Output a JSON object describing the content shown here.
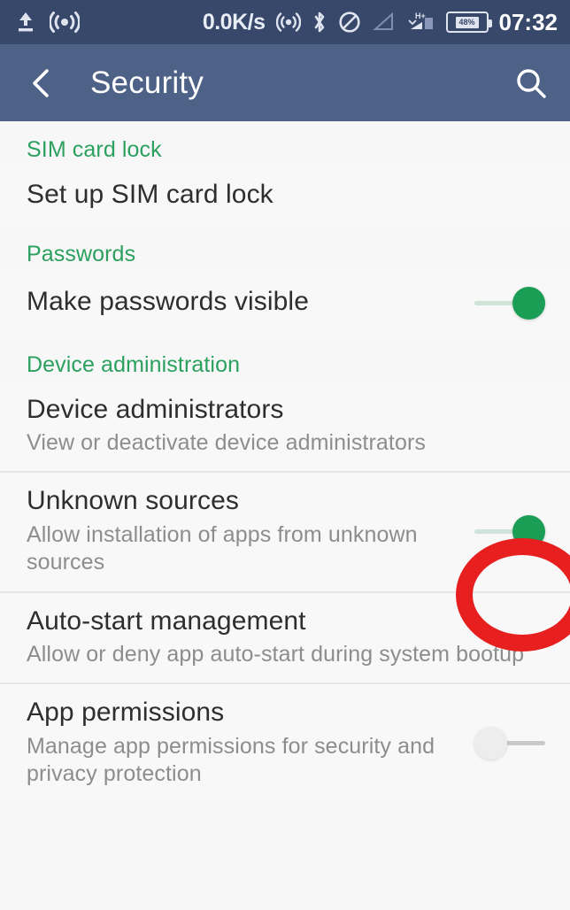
{
  "status_bar": {
    "network_speed": "0.0K/s",
    "clock": "07:32",
    "battery_percent": "48%",
    "icons": [
      "upload-arrow-icon",
      "broadcast-waves-icon",
      "hotspot-icon",
      "bluetooth-icon",
      "do-not-disturb-icon",
      "signal-empty-icon",
      "signal-hplus-icon",
      "battery-icon"
    ]
  },
  "app_bar": {
    "back_icon": "back-chevron-icon",
    "title": "Security",
    "search_icon": "search-icon"
  },
  "colors": {
    "status_bar_bg": "#37486b",
    "app_bar_bg": "#4e6287",
    "section_header_green": "#2ba05f",
    "toggle_on_green": "#1a9e55",
    "annotation_red": "#e81f1f",
    "page_bg": "#f7f7f7"
  },
  "sections": [
    {
      "header": "SIM card lock",
      "items": [
        {
          "title": "Set up SIM card lock",
          "subtitle": "",
          "toggle": null
        }
      ]
    },
    {
      "header": "Passwords",
      "items": [
        {
          "title": "Make passwords visible",
          "subtitle": "",
          "toggle": "on"
        }
      ]
    },
    {
      "header": "Device administration",
      "items": [
        {
          "title": "Device administrators",
          "subtitle": "View or deactivate device administrators",
          "toggle": null
        },
        {
          "title": "Unknown sources",
          "subtitle": "Allow installation of apps from unknown sources",
          "toggle": "on"
        },
        {
          "title": "Auto-start management",
          "subtitle": "Allow or deny app auto-start during system bootup",
          "toggle": null
        },
        {
          "title": "App permissions",
          "subtitle": "Manage app permissions for security and privacy protection",
          "toggle": "off"
        }
      ]
    }
  ],
  "annotation": {
    "shape": "red-circle-highlight",
    "target": "Unknown sources toggle"
  }
}
